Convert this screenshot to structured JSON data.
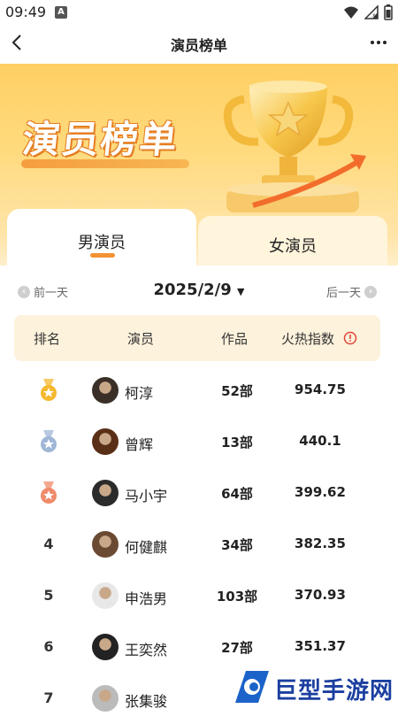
{
  "status": {
    "time": "09:49",
    "notification_letter": "A"
  },
  "nav": {
    "title": "演员榜单"
  },
  "banner": {
    "title": "演员榜单"
  },
  "tabs": [
    {
      "label": "男演员",
      "active": true
    },
    {
      "label": "女演员",
      "active": false
    }
  ],
  "date_nav": {
    "prev": "前一天",
    "date": "2025/2/9",
    "next": "后一天"
  },
  "columns": {
    "rank": "排名",
    "actor": "演员",
    "works": "作品",
    "heat": "火热指数"
  },
  "rows": [
    {
      "rank": "1",
      "medal": "gold",
      "name": "柯淳",
      "works": "52部",
      "heat": "954.75"
    },
    {
      "rank": "2",
      "medal": "silver",
      "name": "曾辉",
      "works": "13部",
      "heat": "440.1"
    },
    {
      "rank": "3",
      "medal": "bronze",
      "name": "马小宇",
      "works": "64部",
      "heat": "399.62"
    },
    {
      "rank": "4",
      "medal": "",
      "name": "何健麒",
      "works": "34部",
      "heat": "382.35"
    },
    {
      "rank": "5",
      "medal": "",
      "name": "申浩男",
      "works": "103部",
      "heat": "370.93"
    },
    {
      "rank": "6",
      "medal": "",
      "name": "王奕然",
      "works": "27部",
      "heat": "351.37"
    },
    {
      "rank": "7",
      "medal": "",
      "name": "张集骏",
      "works": "",
      "heat": ""
    }
  ],
  "watermark": {
    "text": "巨型手游网"
  },
  "colors": {
    "accent": "#f39233",
    "gold": "#f5b82e",
    "silver": "#9fb6d6",
    "bronze": "#f08a6a",
    "info": "#e0463a"
  }
}
